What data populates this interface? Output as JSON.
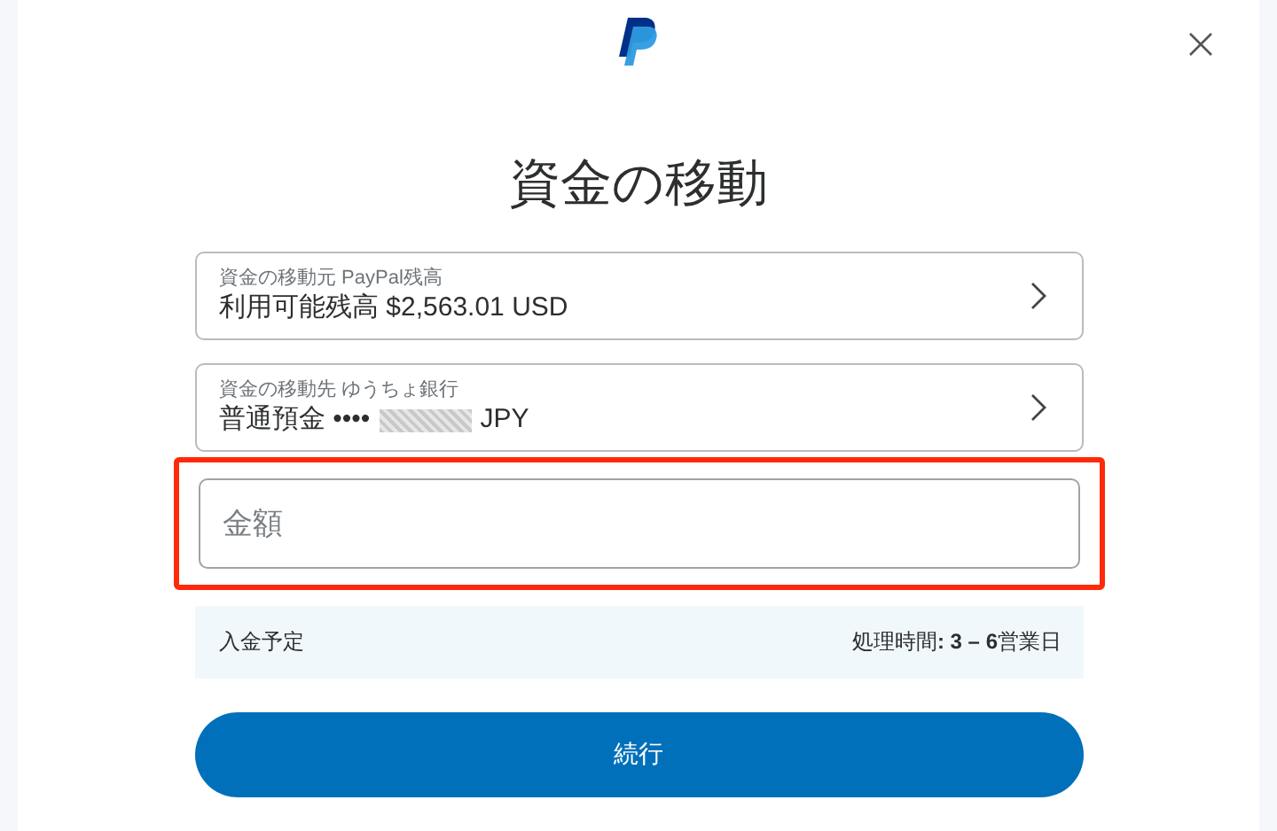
{
  "title": "資金の移動",
  "sources": [
    {
      "label": "資金の移動元 PayPal残高",
      "value": "利用可能残高 $2,563.01 USD",
      "masked": false
    },
    {
      "label": "資金の移動先 ゆうちょ銀行",
      "value": "普通預金 ••••",
      "masked": true,
      "value_suffix": "JPY"
    }
  ],
  "amount": {
    "placeholder": "金額",
    "highlighted": true
  },
  "info": {
    "left": "入金予定",
    "right": "処理時間**: 3 – 6**営業日"
  },
  "button": "続行"
}
